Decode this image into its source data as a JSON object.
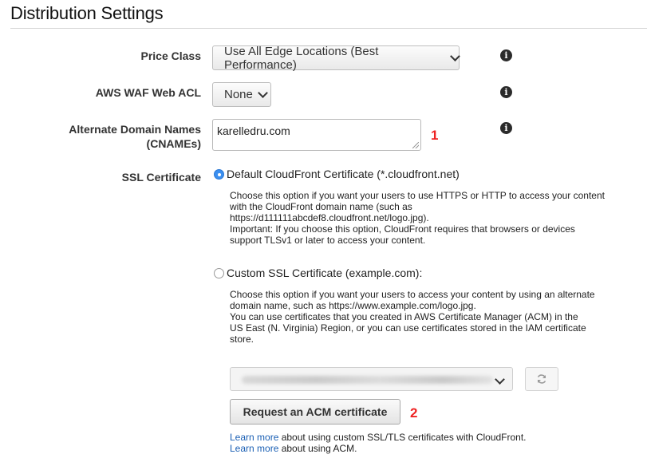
{
  "section_title": "Distribution Settings",
  "price_class": {
    "label": "Price Class",
    "selected": "Use All Edge Locations (Best Performance)"
  },
  "waf": {
    "label": "AWS WAF Web ACL",
    "selected": "None"
  },
  "cnames": {
    "label_line1": "Alternate Domain Names",
    "label_line2": "(CNAMEs)",
    "value": "karelledru.com",
    "annotation": "1"
  },
  "ssl": {
    "label": "SSL Certificate",
    "default_option": {
      "label": "Default CloudFront Certificate (*.cloudfront.net)",
      "selected": true,
      "desc_lines": [
        "Choose this option if you want your users to use HTTPS or HTTP to access your content",
        "with the CloudFront domain name (such as",
        "https://d111111abcdef8.cloudfront.net/logo.jpg).",
        "Important: If you choose this option, CloudFront requires that browsers or devices",
        "support TLSv1 or later to access your content."
      ]
    },
    "custom_option": {
      "label": "Custom SSL Certificate (example.com):",
      "selected": false,
      "desc_lines": [
        "Choose this option if you want your users to access your content by using an alternate",
        "domain name, such as https://www.example.com/logo.jpg.",
        "You can use certificates that you created in AWS Certificate Manager (ACM) in the",
        "US East (N. Virginia) Region, or you can use certificates stored in the IAM certificate",
        "store."
      ]
    },
    "request_acm_label": "Request an ACM certificate",
    "annotation": "2",
    "learn_more_link": "Learn more",
    "learn_more_ssl_text": " about using custom SSL/TLS certificates with CloudFront.",
    "learn_more_acm_text": " about using ACM."
  },
  "icons": {
    "info": "info-icon",
    "refresh": "refresh-icon",
    "chevron": "chevron-down-icon"
  },
  "colors": {
    "annotation": "#e22222",
    "link": "#1a5fb4",
    "radio_selected": "#3b8ff0"
  }
}
